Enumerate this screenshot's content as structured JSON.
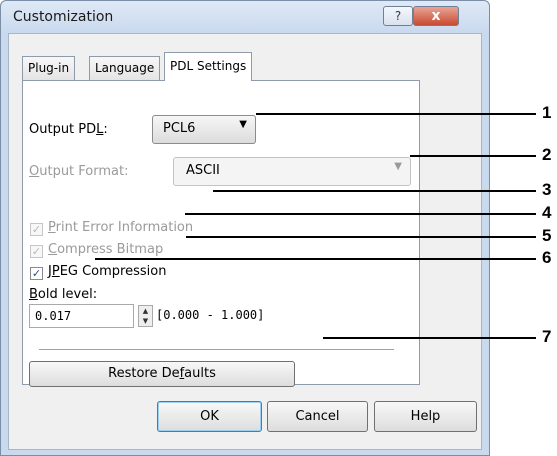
{
  "window": {
    "title": "Customization",
    "help_label": "?",
    "close_label": "x"
  },
  "tabs": [
    {
      "label": "Plug-in",
      "active": false
    },
    {
      "label": "Language",
      "active": false
    },
    {
      "label": "PDL Settings",
      "active": true
    }
  ],
  "form": {
    "output_pdl_label_pre": "Output PD",
    "output_pdl_label_accel": "L",
    "output_pdl_label_post": ":",
    "output_pdl_value": "PCL6",
    "output_format_label_accel": "O",
    "output_format_label_rest": "utput Format:",
    "output_format_value": "ASCII",
    "print_error": {
      "accel": "P",
      "rest": "rint Error Information",
      "checked": true,
      "enabled": false
    },
    "compress_bitmap": {
      "accel": "C",
      "rest": "ompress Bitmap",
      "checked": true,
      "enabled": false
    },
    "jpeg": {
      "pre": "J",
      "accel": "P",
      "rest": "EG Compression",
      "checked": true,
      "enabled": true
    },
    "bold_label_accel": "B",
    "bold_label_rest": "old level:",
    "bold_value": "0.017",
    "bold_range": "[0.000 - 1.000]",
    "restore_pre": "Restore De",
    "restore_accel": "f",
    "restore_post": "aults"
  },
  "footer": {
    "ok_label": "OK",
    "cancel_label": "Cancel",
    "help_label": "Help"
  },
  "callouts": [
    "1",
    "2",
    "3",
    "4",
    "5",
    "6",
    "7"
  ]
}
